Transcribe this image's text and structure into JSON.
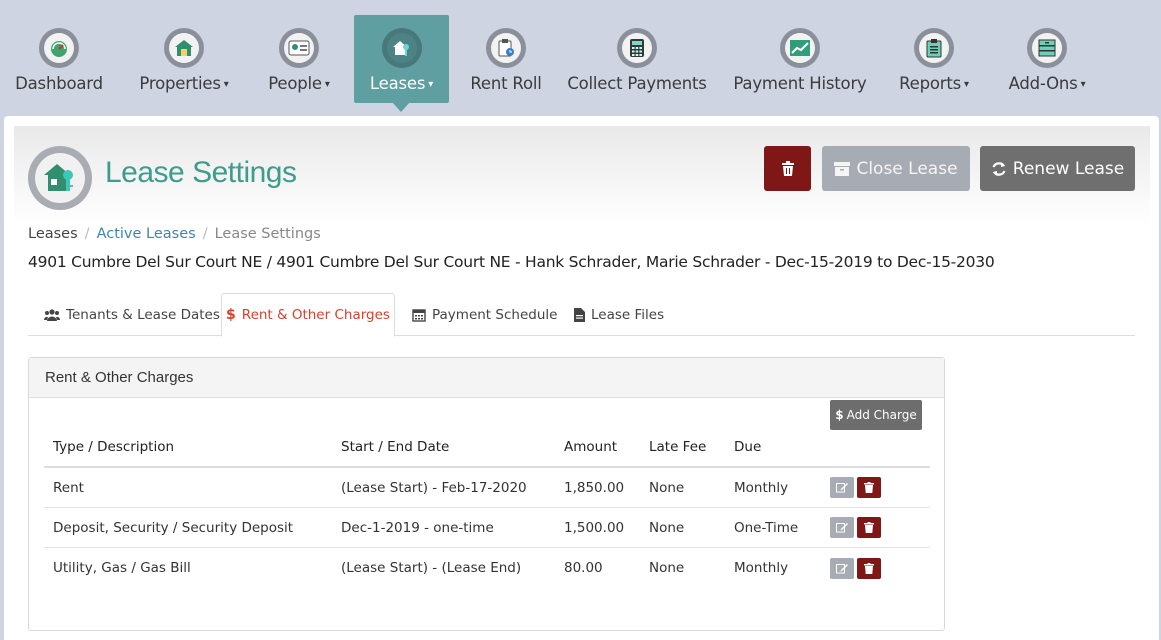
{
  "nav": {
    "items": [
      {
        "label": "Dashboard",
        "icon": "dashboard-gauge-icon",
        "caret": false
      },
      {
        "label": "Properties",
        "icon": "house-icon",
        "caret": true
      },
      {
        "label": "People",
        "icon": "contact-card-icon",
        "caret": true
      },
      {
        "label": "Leases",
        "icon": "house-key-icon",
        "caret": true,
        "active": true
      },
      {
        "label": "Rent Roll",
        "icon": "clipboard-clock-icon",
        "caret": false
      },
      {
        "label": "Collect Payments",
        "icon": "calculator-icon",
        "caret": false
      },
      {
        "label": "Payment History",
        "icon": "line-chart-icon",
        "caret": false
      },
      {
        "label": "Reports",
        "icon": "clipboard-icon",
        "caret": true
      },
      {
        "label": "Add-Ons",
        "icon": "cabinet-icon",
        "caret": true
      }
    ],
    "caret_glyph": "▾"
  },
  "header": {
    "title": "Lease Settings",
    "close_label": "Close Lease",
    "renew_label": "Renew Lease"
  },
  "breadcrumb": {
    "root": "Leases",
    "middle": "Active Leases",
    "current": "Lease Settings",
    "separator": "/"
  },
  "lease_description": "4901 Cumbre Del Sur Court NE / 4901 Cumbre Del Sur Court NE - Hank Schrader, Marie Schrader - Dec-15-2019 to Dec-15-2030",
  "tabs": [
    {
      "label": "Tenants & Lease Dates",
      "icon": "users-icon"
    },
    {
      "label": "Rent & Other Charges",
      "icon": "dollar-icon",
      "active": true
    },
    {
      "label": "Payment Schedule",
      "icon": "calendar-icon"
    },
    {
      "label": "Lease Files",
      "icon": "file-icon"
    }
  ],
  "charges": {
    "heading": "Rent & Other Charges",
    "add_label": "Add Charge",
    "columns": [
      "Type / Description",
      "Start / End Date",
      "Amount",
      "Late Fee",
      "Due"
    ],
    "rows": [
      {
        "type": "Rent",
        "dates": "(Lease Start) - Feb-17-2020",
        "amount": "1,850.00",
        "late_fee": "None",
        "due": "Monthly"
      },
      {
        "type": "Deposit, Security / Security Deposit",
        "dates": "Dec-1-2019 - one-time",
        "amount": "1,500.00",
        "late_fee": "None",
        "due": "One-Time"
      },
      {
        "type": "Utility, Gas / Gas Bill",
        "dates": "(Lease Start) - (Lease End)",
        "amount": "80.00",
        "late_fee": "None",
        "due": "Monthly"
      }
    ]
  },
  "colors": {
    "accent_teal": "#5f9fa2",
    "title_green": "#3d9c8c",
    "danger": "#7f1717",
    "tab_active": "#d9402b",
    "link": "#3a86b8"
  }
}
